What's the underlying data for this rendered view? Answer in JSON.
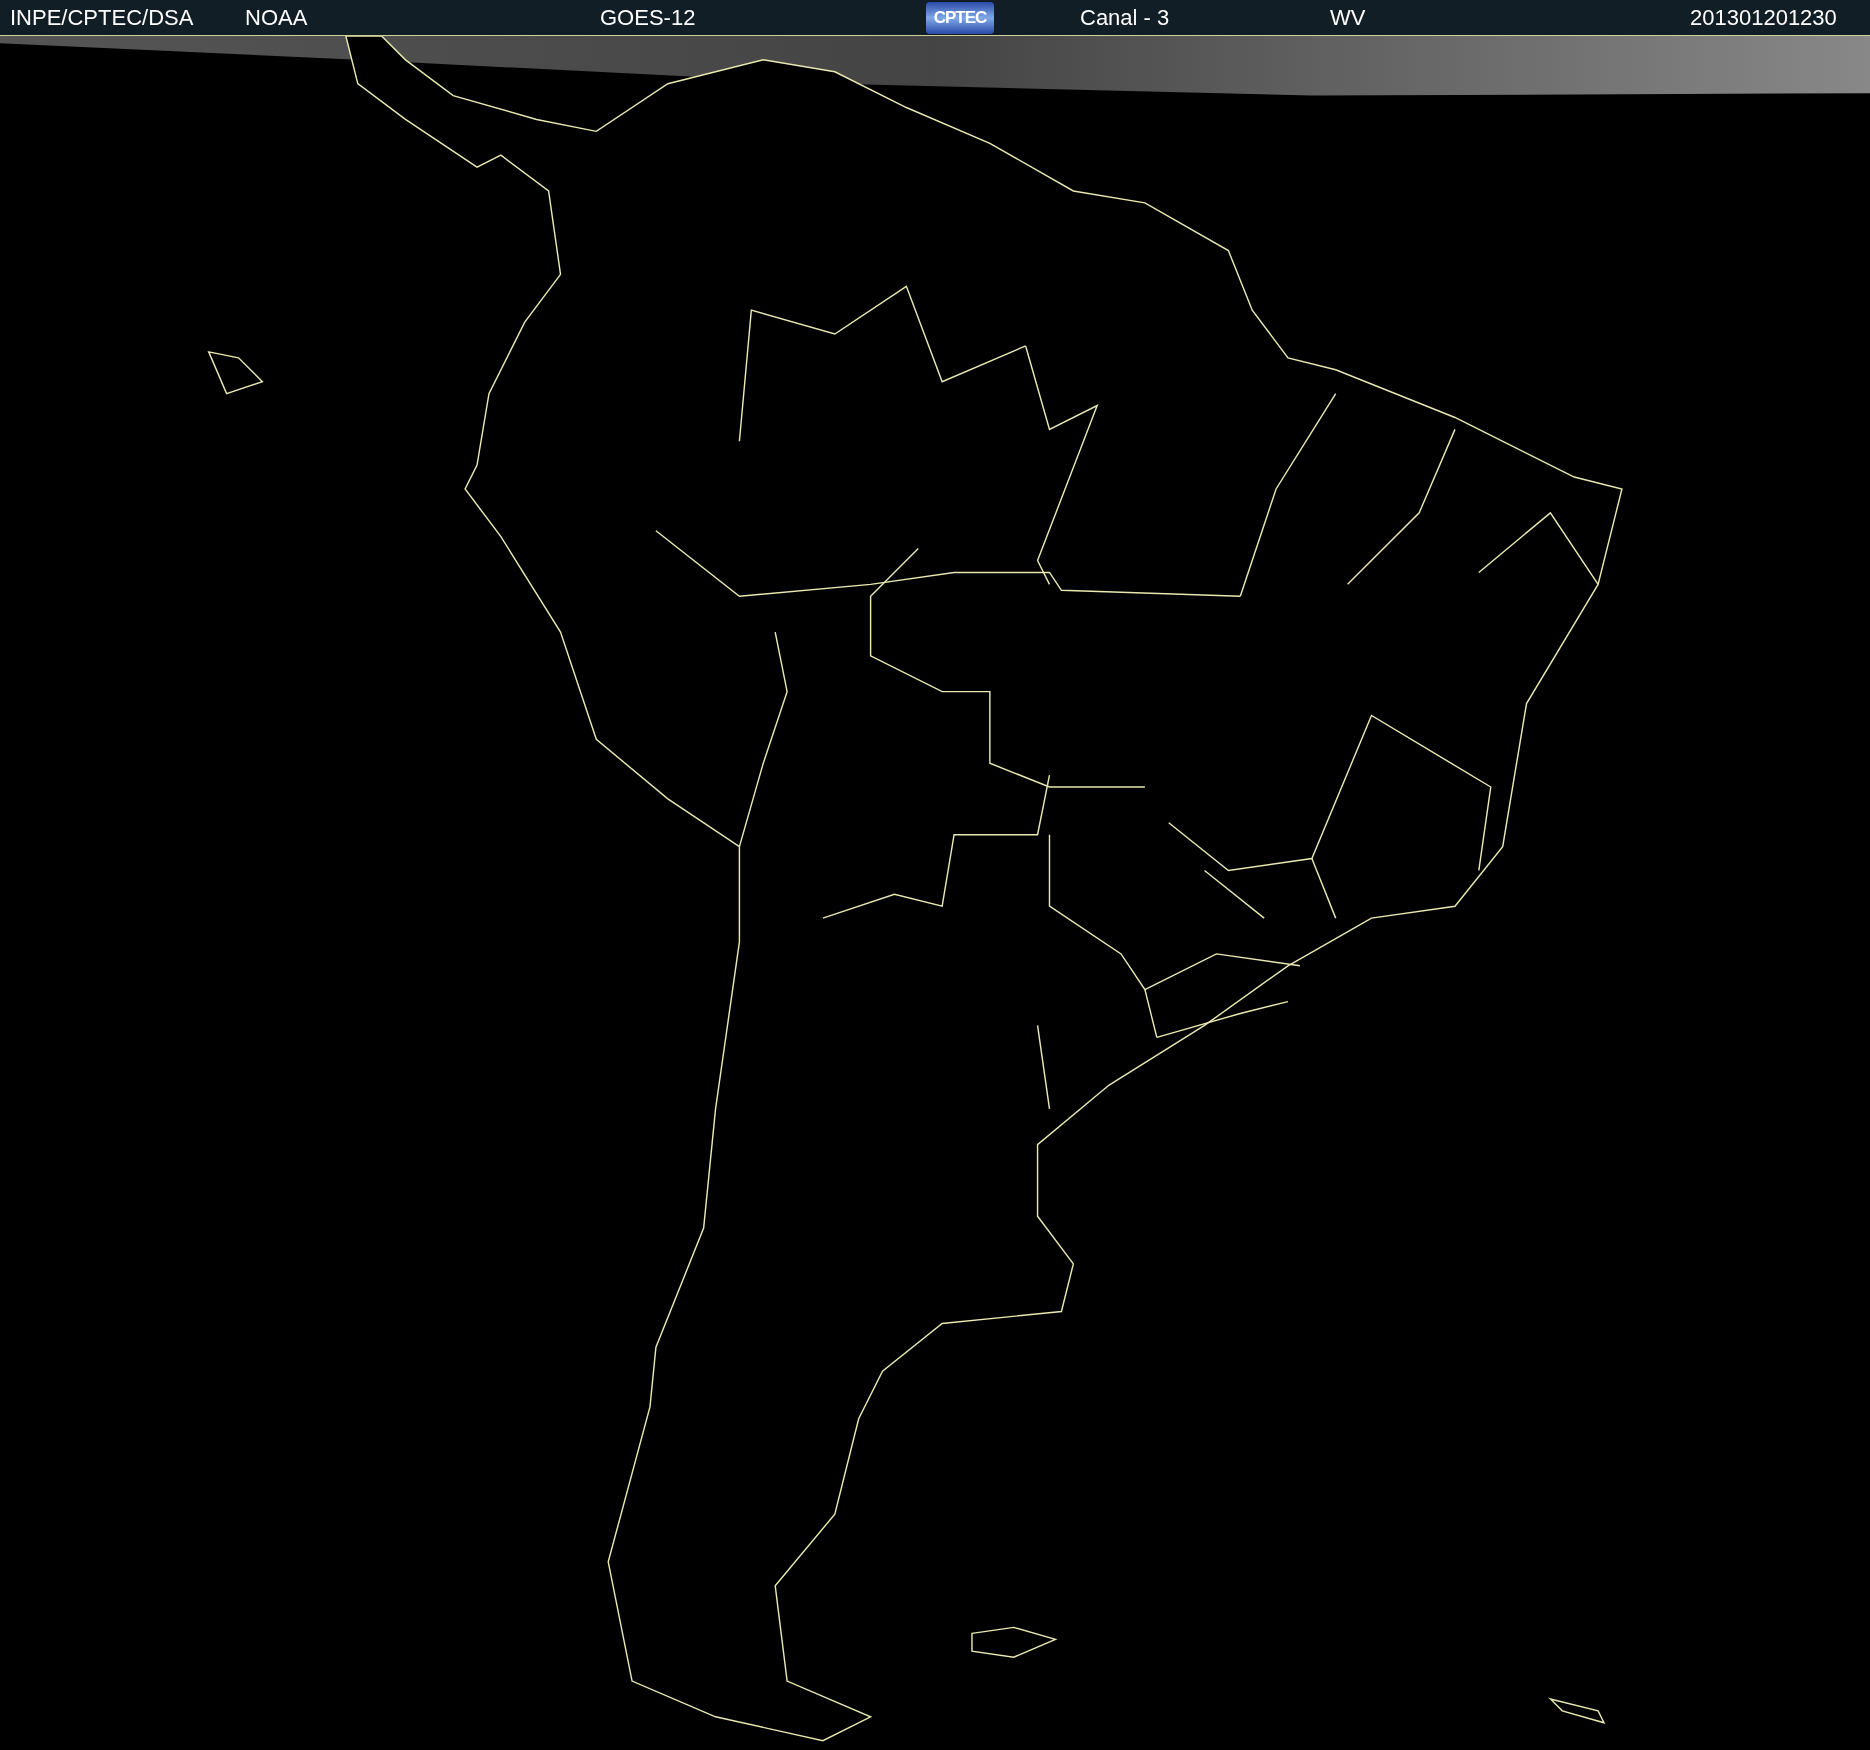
{
  "header": {
    "items": [
      {
        "kind": "text",
        "text": "INPE/CPTEC/DSA"
      },
      {
        "kind": "text",
        "text": "NOAA"
      },
      {
        "kind": "text",
        "text": "GOES-12"
      },
      {
        "kind": "logo",
        "text": "CPTEC"
      },
      {
        "kind": "text",
        "text": "Canal - 3"
      },
      {
        "kind": "text",
        "text": "WV"
      },
      {
        "kind": "text",
        "text": "201301201230"
      }
    ]
  }
}
